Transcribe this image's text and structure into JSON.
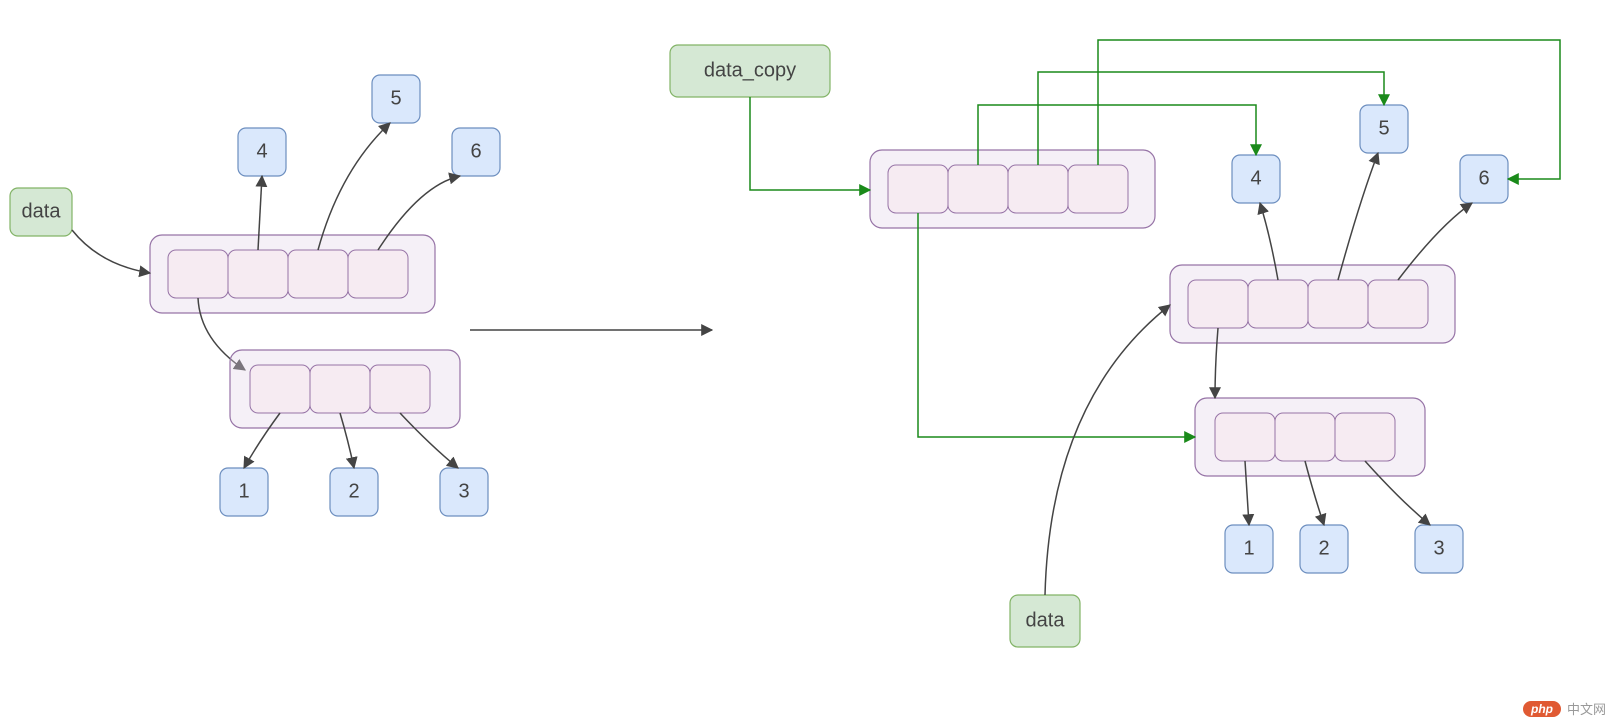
{
  "labels": {
    "data": "data",
    "data_copy": "data_copy"
  },
  "left": {
    "outer_nums": [
      "4",
      "5",
      "6"
    ],
    "inner_nums": [
      "1",
      "2",
      "3"
    ]
  },
  "right": {
    "copy_outer_nums": [
      "4",
      "5",
      "6"
    ],
    "data_outer_nums": [
      "4",
      "5",
      "6"
    ],
    "inner_nums": [
      "1",
      "2",
      "3"
    ]
  },
  "watermark": "中文网"
}
